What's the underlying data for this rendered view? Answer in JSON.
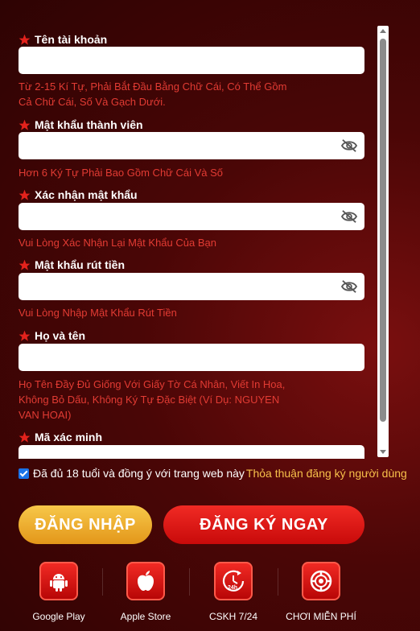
{
  "fields": [
    {
      "label": "Tên tài khoản",
      "hint": "Từ 2-15 Kí Tự, Phải Bắt Đầu Bằng Chữ Cái, Có Thể Gồm Cả Chữ Cái, Số Và Gạch Dưới.",
      "value": "",
      "password": false
    },
    {
      "label": "Mật khẩu thành viên",
      "hint": "Hơn 6 Ký Tự Phải Bao Gồm Chữ Cái Và Số",
      "value": "",
      "password": true
    },
    {
      "label": "Xác nhận mật khẩu",
      "hint": "Vui Lòng Xác Nhận Lại Mật Khẩu Của Bạn",
      "value": "",
      "password": true
    },
    {
      "label": "Mật khẩu rút tiền",
      "hint": "Vui Lòng Nhập Mật Khẩu Rút Tiền",
      "value": "",
      "password": true
    },
    {
      "label": "Họ và tên",
      "hint": "Họ Tên Đầy Đủ Giống Với Giấy Tờ Cá Nhân, Viết In Hoa, Không Bỏ Dấu, Không Ký Tự Đặc Biệt (Ví Dụ: NGUYEN VAN HOAI)",
      "value": "",
      "password": false
    },
    {
      "label": "Mã xác minh",
      "hint": "",
      "value": "",
      "password": false
    }
  ],
  "agreement": {
    "checked": true,
    "text": "Đã đủ 18 tuổi và đồng ý với trang web này",
    "link": "Thỏa thuận đăng ký người dùng"
  },
  "buttons": {
    "login": "ĐĂNG NHẬP",
    "register": "ĐĂNG KÝ NGAY"
  },
  "footer": [
    {
      "label": "Google Play",
      "icon": "android-icon"
    },
    {
      "label": "Apple Store",
      "icon": "apple-icon"
    },
    {
      "label": "CSKH 7/24",
      "icon": "support-24h-icon"
    },
    {
      "label": "CHƠI MIỄN PHÍ",
      "icon": "chip-icon"
    }
  ],
  "colors": {
    "accent_red": "#e3221c",
    "hint_red": "#e23b33",
    "gold": "#f7c04a"
  }
}
